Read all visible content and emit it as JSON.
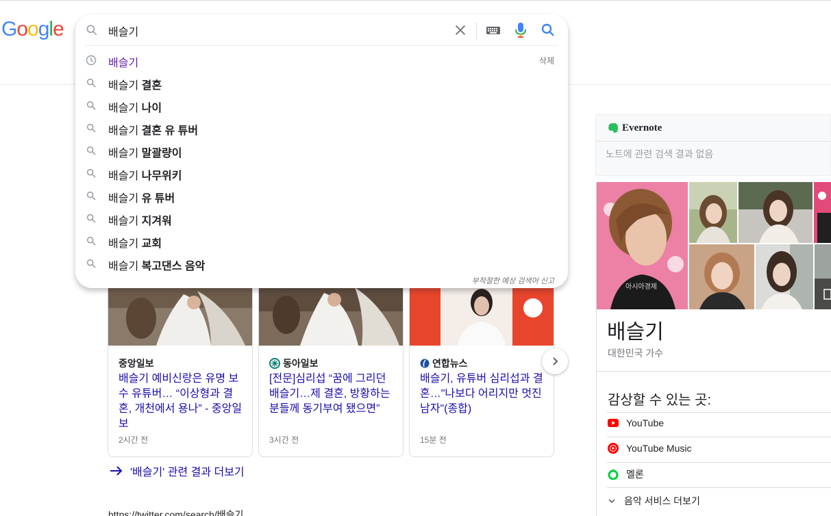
{
  "logo": {
    "letters": [
      "G",
      "o",
      "o",
      "g",
      "l",
      "e"
    ],
    "colors": [
      "#4285f4",
      "#ea4335",
      "#fbbc05",
      "#4285f4",
      "#34a853",
      "#ea4335"
    ]
  },
  "search": {
    "query": "배슬기",
    "icons": [
      "search-icon",
      "clear-icon",
      "keyboard-icon",
      "mic-icon",
      "search-icon"
    ]
  },
  "suggestions": {
    "history": {
      "text": "배슬기",
      "delete_label": "삭제"
    },
    "items": [
      {
        "prefix": "배슬기",
        "bold": " 결혼"
      },
      {
        "prefix": "배슬기",
        "bold": " 나이"
      },
      {
        "prefix": "배슬기",
        "bold": " 결혼 유 튜버"
      },
      {
        "prefix": "배슬기",
        "bold": " 말괄량이"
      },
      {
        "prefix": "배슬기",
        "bold": " 나무위키"
      },
      {
        "prefix": "배슬기",
        "bold": " 유 튜버"
      },
      {
        "prefix": "배슬기",
        "bold": " 지겨워"
      },
      {
        "prefix": "배슬기",
        "bold": " 교회"
      },
      {
        "prefix": "배슬기",
        "bold": " 복고댄스 음악"
      }
    ],
    "report_label": "부적절한 예상 검색어 신고"
  },
  "news": [
    {
      "source": "중앙일보",
      "headline": "배슬기 예비신랑은 유명 보수 유튜버… “이상형과 결혼, 개천에서 용나” - 중앙일보",
      "age": "2시간 전"
    },
    {
      "source": "동아일보",
      "headline": "[전문]심리섭 “꿈에 그리던 배슬기…제 결혼, 방황하는 분들께 동기부여 됐으면”",
      "age": "3시간 전"
    },
    {
      "source": "연합뉴스",
      "headline": "배슬기, 유튜버 심리섭과 결혼…\"나보다 어리지만 멋진 남자\"(종합)",
      "age": "15분 전"
    }
  ],
  "more_results": "'배슬기' 관련 결과 더보기",
  "twitter_url": "https://twitter.com/search/배슬기",
  "evernote": {
    "title": "Evernote",
    "message": "노트에 관련 검색 결과 없음"
  },
  "knowledge_panel": {
    "photo_caption": "아시아경제",
    "name": "배슬기",
    "description": "대한민국 가수",
    "watch_title": "감상할 수 있는 곳:",
    "services": [
      {
        "name": "YouTube",
        "color": "#ff0000"
      },
      {
        "name": "YouTube Music",
        "color": "#ff0000"
      },
      {
        "name": "멜론",
        "color": "#00cd3c"
      }
    ],
    "more_services": "음악 서비스 더보기"
  }
}
